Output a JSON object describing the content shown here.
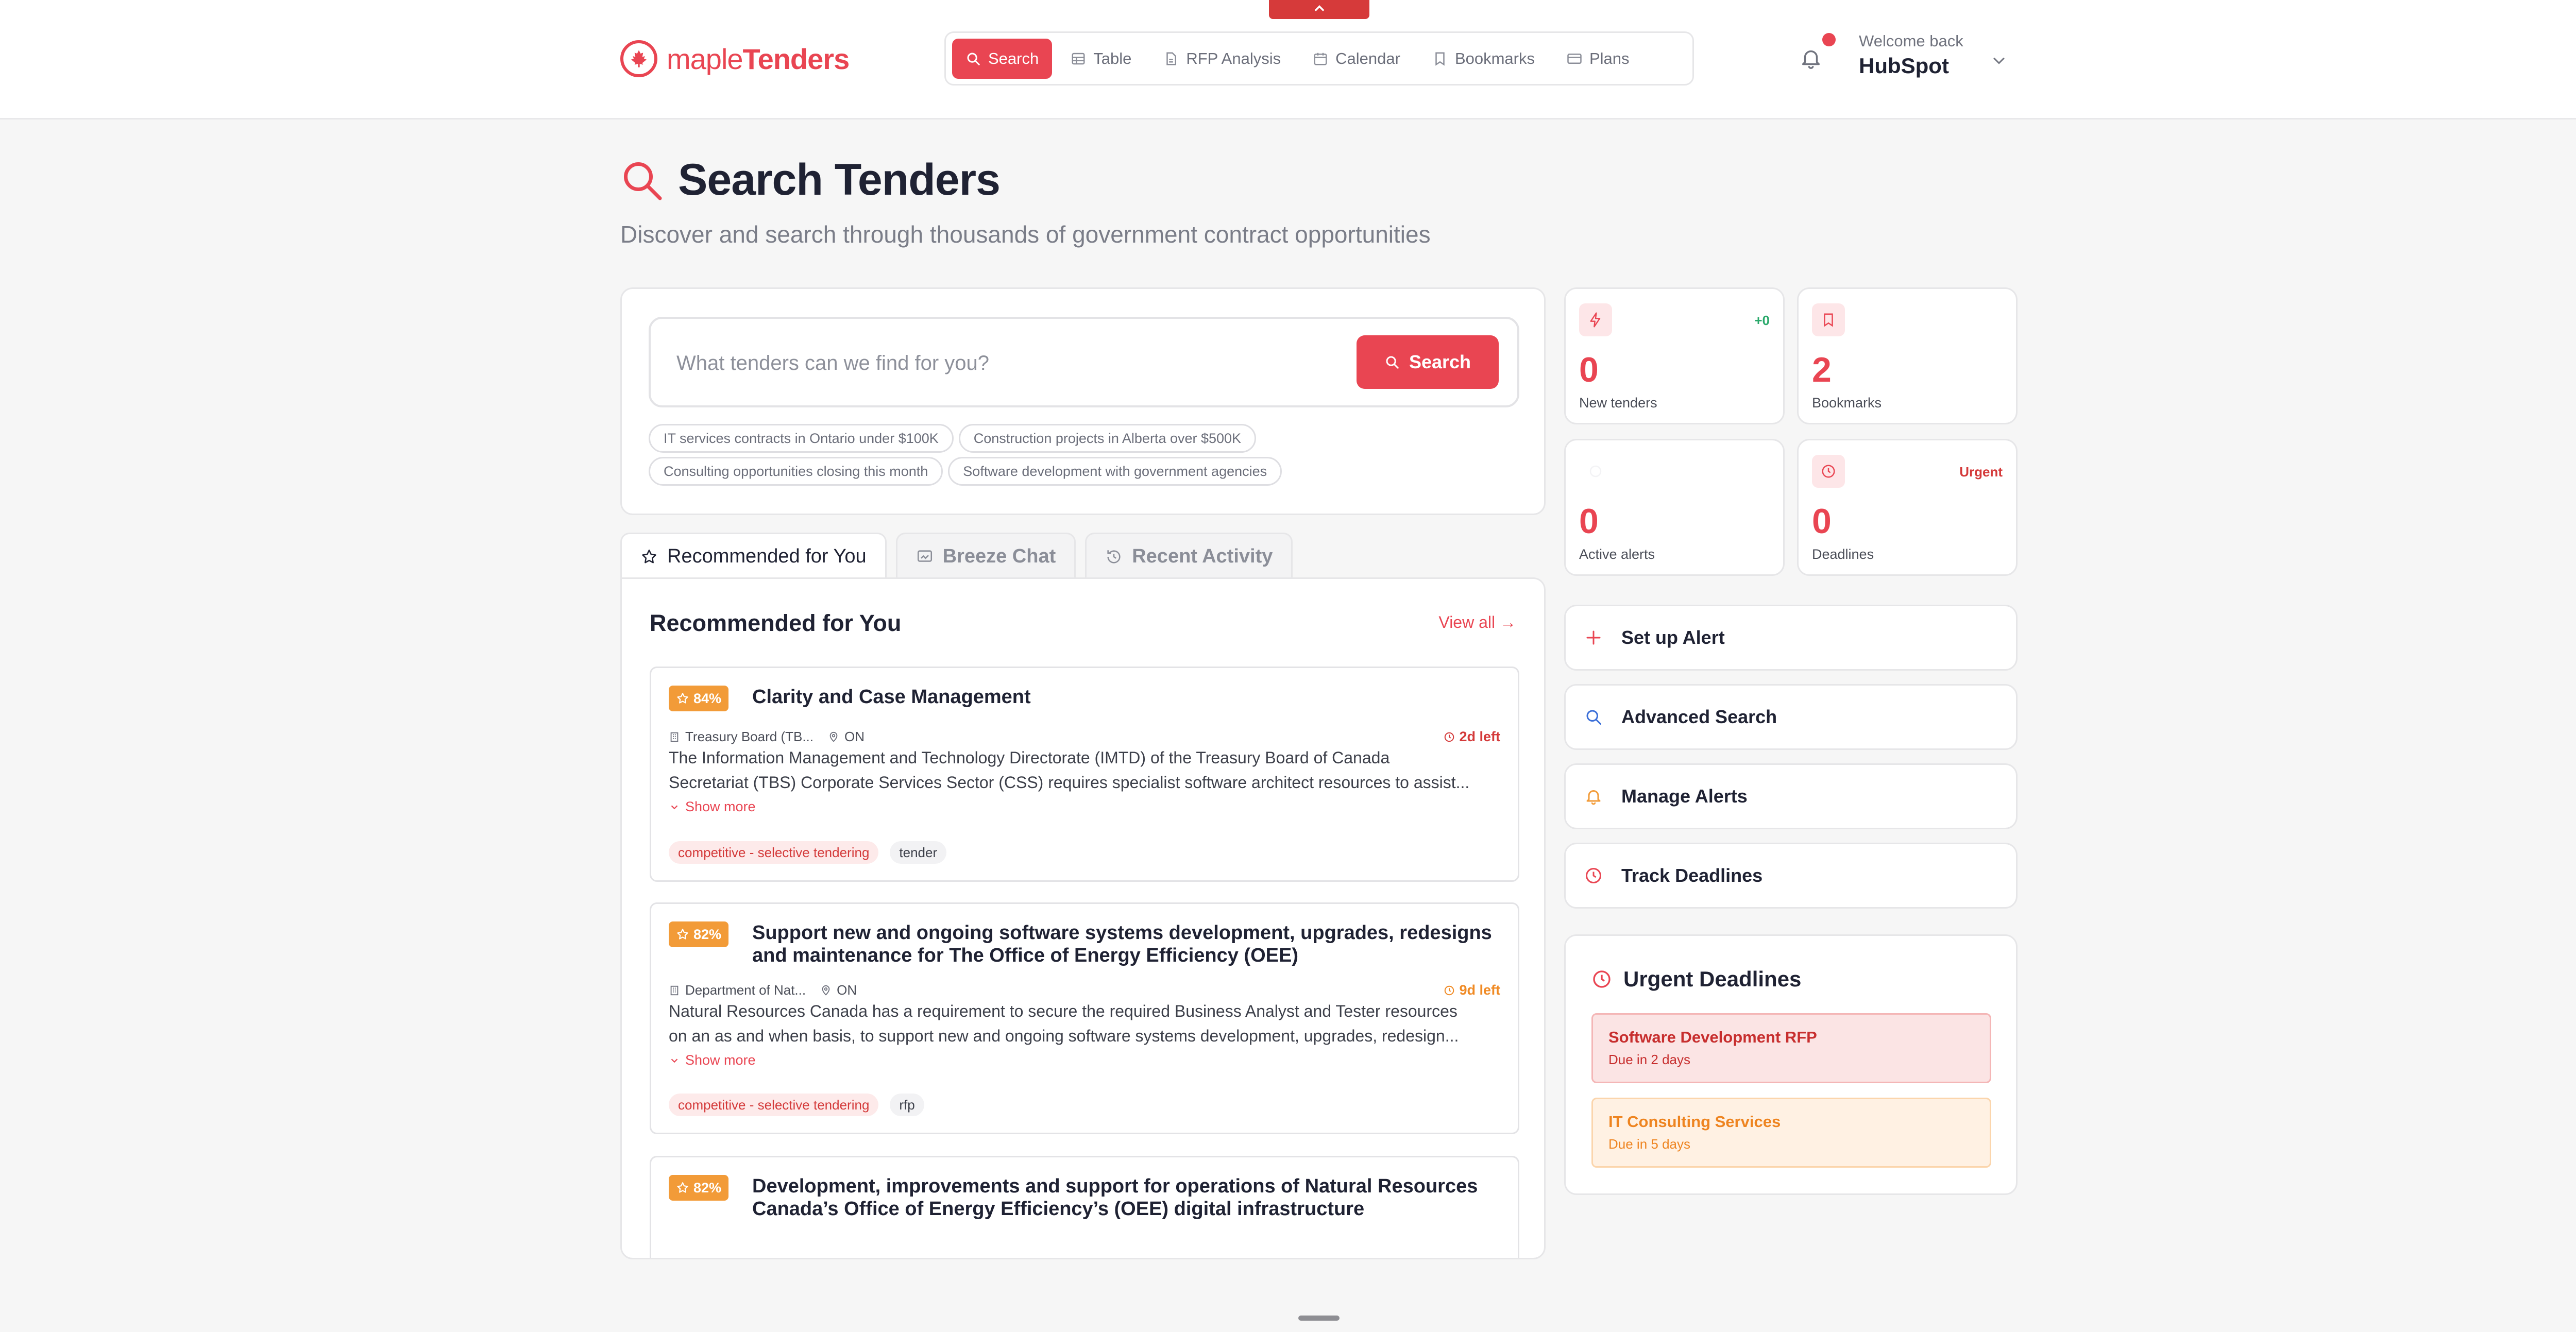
{
  "brand": {
    "name_light": "maple",
    "name_bold": "Tenders",
    "color": "#e94552"
  },
  "nav": {
    "items": [
      {
        "label": "Search",
        "icon": "search-icon",
        "active": true
      },
      {
        "label": "Table",
        "icon": "table-icon"
      },
      {
        "label": "RFP Analysis",
        "icon": "document-icon"
      },
      {
        "label": "Calendar",
        "icon": "calendar-icon"
      },
      {
        "label": "Bookmarks",
        "icon": "bookmark-icon"
      },
      {
        "label": "Plans",
        "icon": "credit-card-icon"
      }
    ]
  },
  "account": {
    "welcome_label": "Welcome back",
    "name": "HubSpot"
  },
  "page": {
    "title": "Search Tenders",
    "subtitle": "Discover and search through thousands of government contract opportunities"
  },
  "search": {
    "placeholder": "What tenders can we find for you?",
    "button_label": "Search",
    "suggestions": [
      "IT services contracts in Ontario under $100K",
      "Construction projects in Alberta over $500K",
      "Consulting opportunities closing this month",
      "Software development with government agencies"
    ]
  },
  "tabs": [
    {
      "label": "Recommended for You",
      "icon": "star-icon",
      "active": true
    },
    {
      "label": "Breeze Chat",
      "icon": "chat-icon"
    },
    {
      "label": "Recent Activity",
      "icon": "history-icon"
    }
  ],
  "recommended": {
    "heading": "Recommended for You",
    "view_all": "View all →",
    "tenders": [
      {
        "score": "84%",
        "title": "Clarity and Case Management",
        "org": "Treasury Board (TB...",
        "province": "ON",
        "due": "2d left",
        "due_level": "red",
        "desc_1": "The Information Management and Technology Directorate (IMTD) of the Treasury Board of Canada",
        "desc_2": "Secretariat (TBS) Corporate Services Sector (CSS) requires specialist software architect resources to assist...",
        "show_more": "Show more",
        "tags": [
          "competitive - selective tendering",
          "tender"
        ]
      },
      {
        "score": "82%",
        "title": "Support new and ongoing software systems development, upgrades, redesigns and maintenance for The Office of Energy Efficiency (OEE)",
        "org": "Department of Nat...",
        "province": "ON",
        "due": "9d left",
        "due_level": "orange",
        "desc_1": "Natural Resources Canada has a requirement to secure the required Business Analyst and Tester resources",
        "desc_2": "on an as and when basis, to support new and ongoing software systems development, upgrades, redesign...",
        "show_more": "Show more",
        "tags": [
          "competitive - selective tendering",
          "rfp"
        ]
      },
      {
        "score": "82%",
        "title": "Development, improvements and support for operations of Natural Resources Canada’s Office of Energy Efficiency’s (OEE) digital infrastructure"
      }
    ]
  },
  "stats": [
    {
      "value": "0",
      "label": "New tenders",
      "badge": "+0",
      "icon": "lightning-icon"
    },
    {
      "value": "2",
      "label": "Bookmarks",
      "icon": "bookmark-icon"
    },
    {
      "value": "0",
      "label": "Active alerts",
      "icon": "bell-icon"
    },
    {
      "value": "0",
      "label": "Deadlines",
      "badge": "Urgent",
      "icon": "clock-icon"
    }
  ],
  "actions": [
    {
      "label": "Set up Alert",
      "icon": "plus-icon"
    },
    {
      "label": "Advanced Search",
      "icon": "search-icon"
    },
    {
      "label": "Manage Alerts",
      "icon": "bell-icon"
    },
    {
      "label": "Track Deadlines",
      "icon": "clock-icon"
    }
  ],
  "urgent": {
    "heading": "Urgent Deadlines",
    "items": [
      {
        "title": "Software Development RFP",
        "due": "Due in 2 days",
        "level": "red"
      },
      {
        "title": "IT Consulting Services",
        "due": "Due in 5 days",
        "level": "orange"
      }
    ]
  }
}
